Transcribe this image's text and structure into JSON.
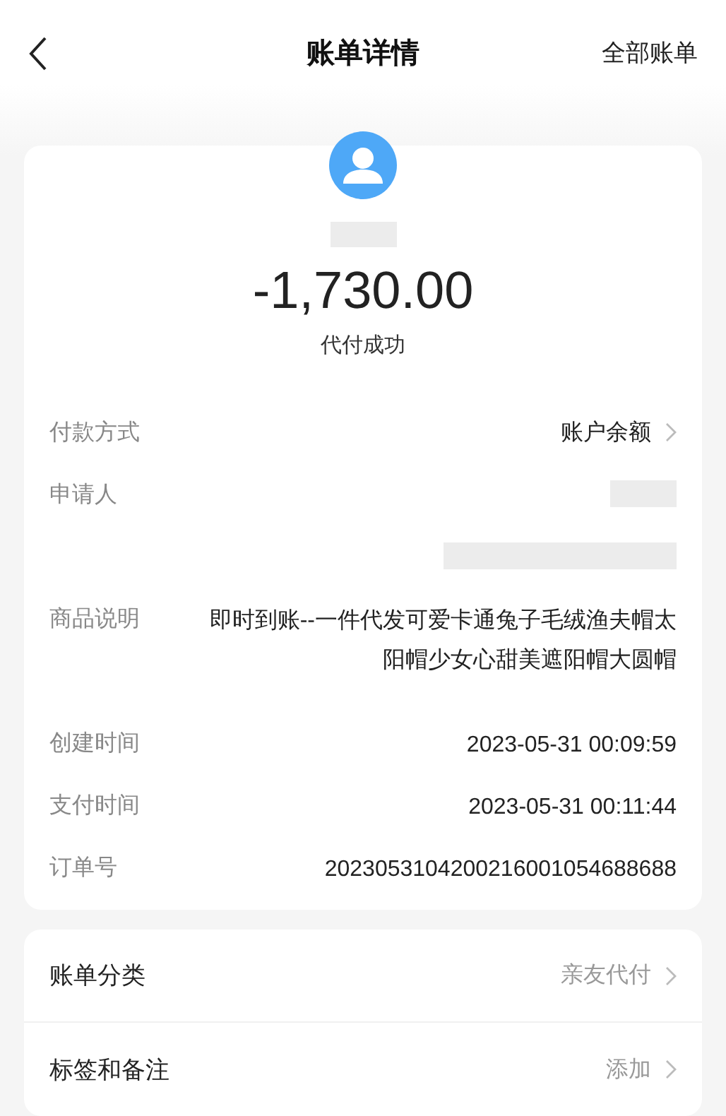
{
  "header": {
    "title": "账单详情",
    "action": "全部账单"
  },
  "summary": {
    "amount": "-1,730.00",
    "status": "代付成功"
  },
  "details": [
    {
      "kind": "link",
      "label": "付款方式",
      "value": "账户余额"
    },
    {
      "kind": "redacted",
      "label": "申请人"
    },
    {
      "kind": "redacted"
    },
    {
      "kind": "multiline",
      "label": "商品说明",
      "value": "即时到账--一件代发可爱卡通兔子毛绒渔夫帽太阳帽少女心甜美遮阳帽大圆帽"
    },
    {
      "kind": "text",
      "label": "创建时间",
      "value": "2023-05-31 00:09:59"
    },
    {
      "kind": "text",
      "label": "支付时间",
      "value": "2023-05-31 00:11:44"
    },
    {
      "kind": "text",
      "label": "订单号",
      "value": "2023053104200216001054688688"
    }
  ],
  "settings": [
    {
      "label": "账单分类",
      "value": "亲友代付"
    },
    {
      "label": "标签和备注",
      "value": "添加"
    }
  ]
}
